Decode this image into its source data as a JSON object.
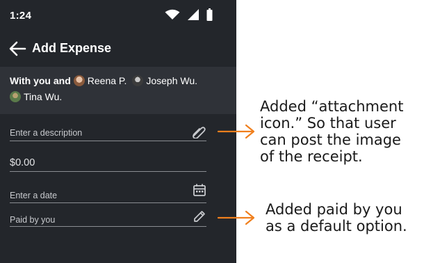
{
  "status_bar": {
    "time": "1:24"
  },
  "app_bar": {
    "title": "Add Expense"
  },
  "participants": {
    "prefix": "With you and",
    "names": [
      "Reena P.",
      "Joseph Wu.",
      "Tina Wu."
    ]
  },
  "form": {
    "description": {
      "placeholder": "Enter a description"
    },
    "amount": {
      "value": "$0.00"
    },
    "date": {
      "placeholder": "Enter a date"
    },
    "paid_by": {
      "value": "Paid by you"
    }
  },
  "annotations": [
    {
      "lines": [
        "Added “attachment",
        "icon.” So that user",
        "can post the image",
        "of the receipt."
      ]
    },
    {
      "lines": [
        "Added paid by you",
        "as a default option."
      ]
    }
  ],
  "colors": {
    "phone_background": "#23262b",
    "participants_background": "#2f3238",
    "arrow": "#f07f1d"
  }
}
